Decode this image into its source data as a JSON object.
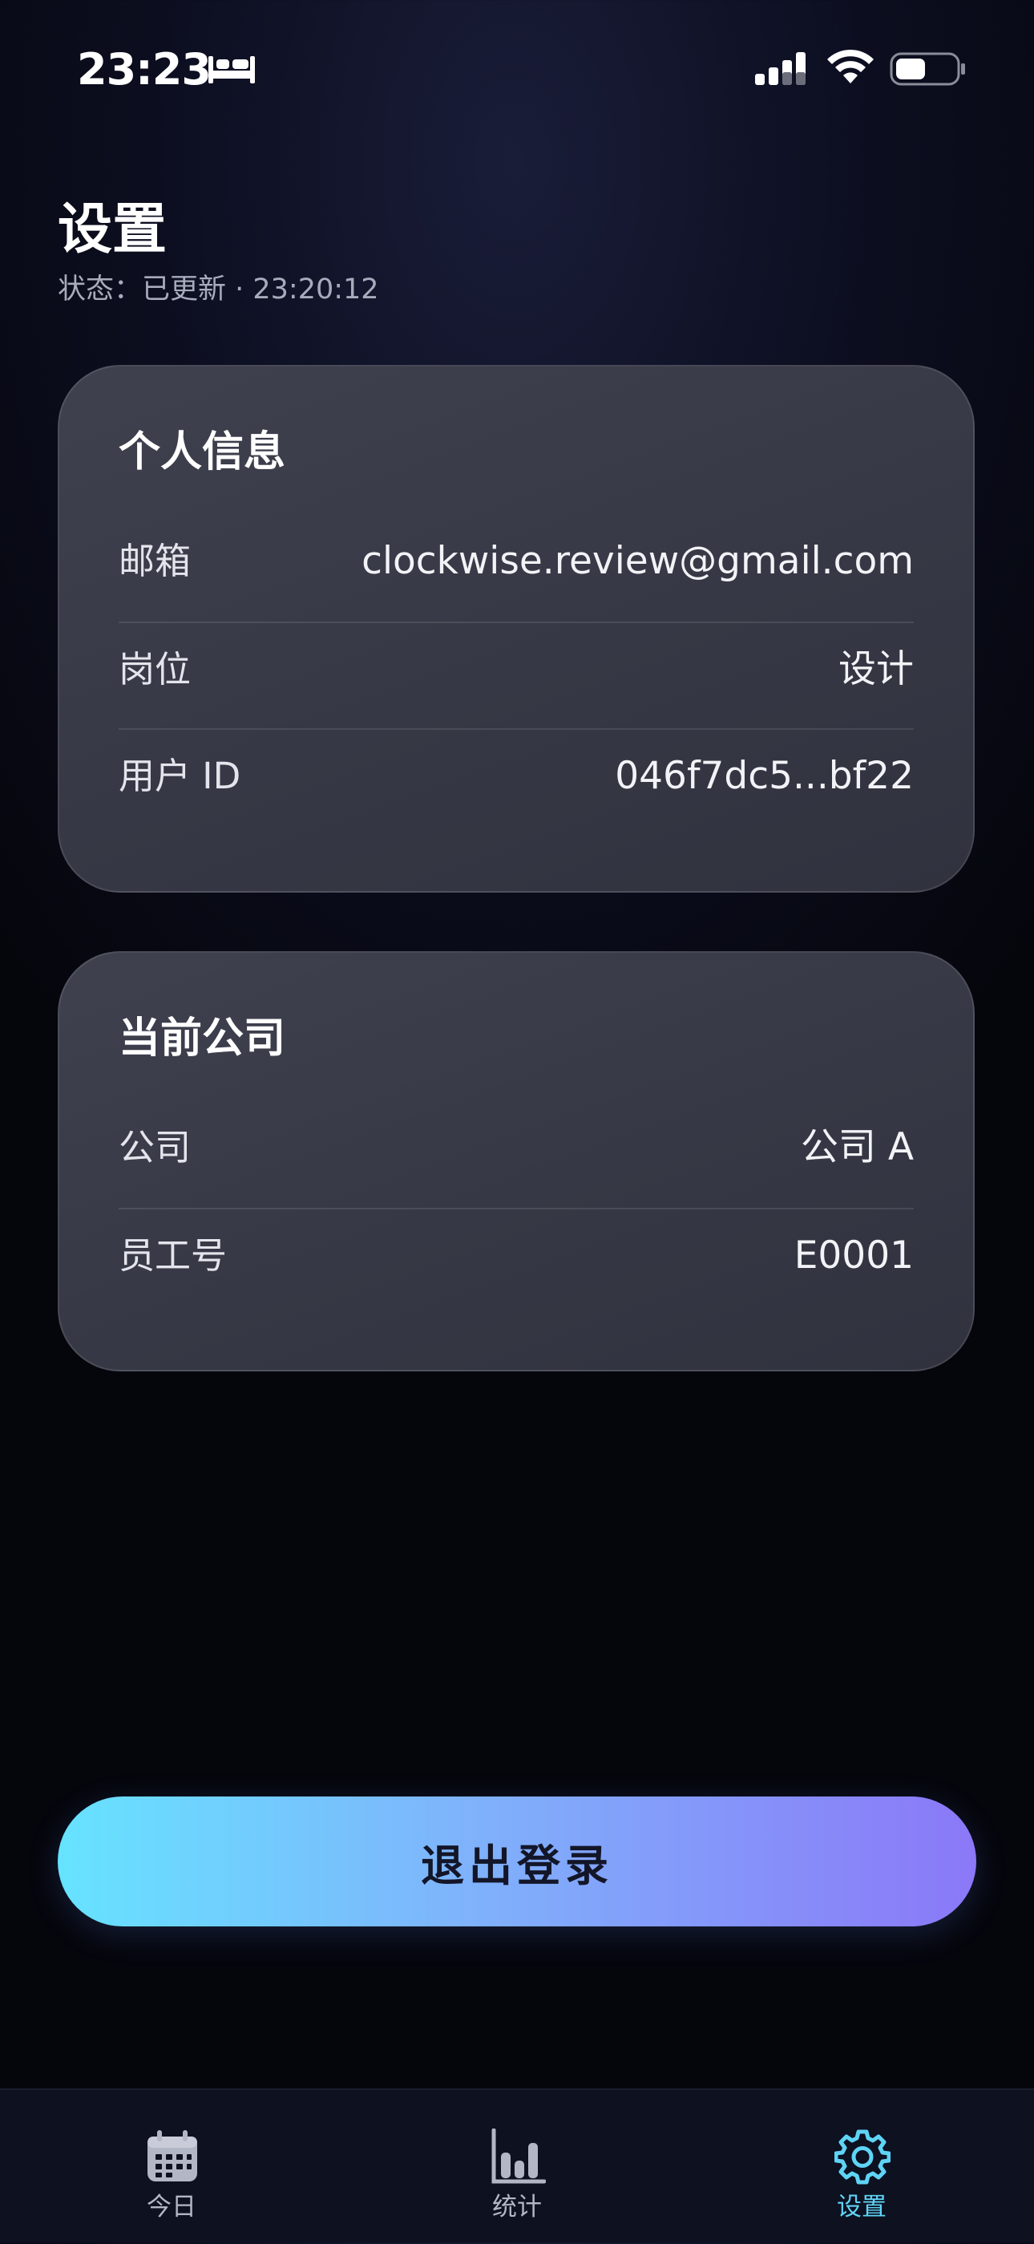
{
  "status_bar": {
    "time": "23:23",
    "focus_icon": "bed-icon",
    "signal_icon": "cellular-signal-icon",
    "wifi_icon": "wifi-icon",
    "battery_icon": "battery-icon",
    "battery_level": 0.5
  },
  "header": {
    "title": "设置",
    "status_text": "状态：已更新 · 23:20:12"
  },
  "personal_info": {
    "title": "个人信息",
    "rows": [
      {
        "label": "邮箱",
        "value": "clockwise.review@gmail.com"
      },
      {
        "label": "岗位",
        "value": "设计"
      },
      {
        "label": "用户 ID",
        "value": "046f7dc5...bf22"
      }
    ]
  },
  "company_info": {
    "title": "当前公司",
    "rows": [
      {
        "label": "公司",
        "value": "公司 A"
      },
      {
        "label": "员工号",
        "value": "E0001"
      }
    ]
  },
  "logout": {
    "label": "退出登录"
  },
  "tab_bar": {
    "tabs": [
      {
        "label": "今日",
        "icon": "calendar-icon",
        "active": false
      },
      {
        "label": "统计",
        "icon": "bar-chart-icon",
        "active": false
      },
      {
        "label": "设置",
        "icon": "gear-icon",
        "active": true
      }
    ]
  },
  "colors": {
    "accent": "#5fd4f5",
    "button_gradient_start": "#66e3ff",
    "button_gradient_end": "#8b78f8",
    "card_background": "#3a3c48",
    "background": "#070811"
  }
}
